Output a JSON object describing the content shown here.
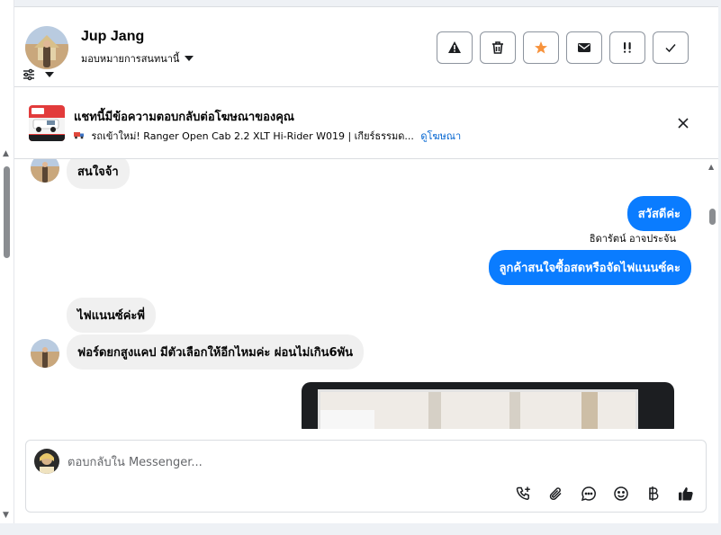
{
  "header": {
    "contact_name": "Jup Jang",
    "assign_label": "มอบหมายการสนทนานี้"
  },
  "actions": [
    {
      "name": "spam-button",
      "icon": "warning-icon"
    },
    {
      "name": "delete-button",
      "icon": "trash-icon"
    },
    {
      "name": "star-button",
      "icon": "star-icon",
      "color": "#f7923b"
    },
    {
      "name": "mark-unread-button",
      "icon": "envelope-icon"
    },
    {
      "name": "follow-up-button",
      "icon": "double-exclamation-icon"
    },
    {
      "name": "done-button",
      "icon": "check-icon"
    }
  ],
  "ad": {
    "title": "แชทนี้มีข้อความตอบกลับต่อโฆษณาของคุณ",
    "subtitle": "รถเข้าใหม่! Ranger Open Cab 2.2 XLT Hi-Rider W019 | เกียร์ธรรมด...",
    "link": "ดูโฆษณา"
  },
  "messages": [
    {
      "direction": "in",
      "text": "สนใจจ้า"
    },
    {
      "direction": "out",
      "text": "สวัสดีค่ะ"
    },
    {
      "direction": "out",
      "sender": "ธิดารัตน์ อาจประจัน",
      "text": "ลูกค้าสนใจซื้อสดหรือจัดไฟแนนซ์คะ"
    },
    {
      "direction": "in",
      "text": "ไฟแนนซ์ค่ะพี่"
    },
    {
      "direction": "in",
      "text": "ฟอร์ดยกสูงแคป มีตัวเลือกให้อีกไหมค่ะ ผ่อนไม่เกิน6พัน"
    }
  ],
  "composer": {
    "placeholder": "ตอบกลับใน Messenger..."
  },
  "colors": {
    "outgoing_bubble": "#0a7cff",
    "incoming_bubble": "#f0f0f0",
    "link": "#0064d1"
  }
}
